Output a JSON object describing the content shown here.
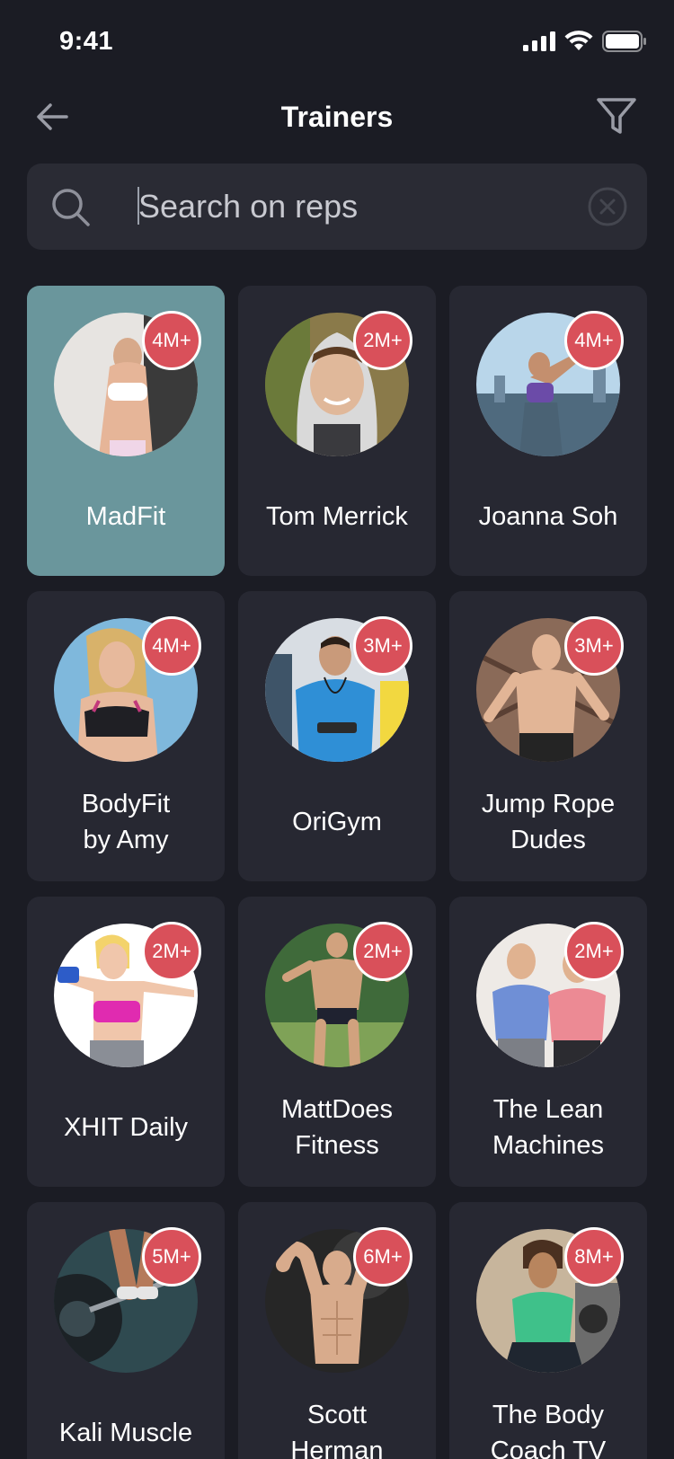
{
  "status": {
    "time": "9:41"
  },
  "header": {
    "title": "Trainers"
  },
  "search": {
    "placeholder": "Search on reps",
    "value": ""
  },
  "colors": {
    "background": "#1b1c24",
    "card": "#272832",
    "selected_card": "#6a969c",
    "badge": "#d9505a"
  },
  "icons": {
    "back": "arrow-left-icon",
    "filter": "funnel-icon",
    "search": "search-icon",
    "clear": "clear-circle-icon"
  },
  "trainers": [
    {
      "name": "MadFit",
      "badge": "4M+",
      "selected": true
    },
    {
      "name": "Tom Merrick",
      "badge": "2M+"
    },
    {
      "name": "Joanna Soh",
      "badge": "4M+"
    },
    {
      "name": "BodyFit\nby Amy",
      "badge": "4M+"
    },
    {
      "name": "OriGym",
      "badge": "3M+"
    },
    {
      "name": "Jump Rope\nDudes",
      "badge": "3M+"
    },
    {
      "name": "XHIT Daily",
      "badge": "2M+"
    },
    {
      "name": "MattDoes\nFitness",
      "badge": "2M+"
    },
    {
      "name": "The Lean\nMachines",
      "badge": "2M+"
    },
    {
      "name": "Kali Muscle",
      "badge": "5M+"
    },
    {
      "name": "Scott\nHerman",
      "badge": "6M+"
    },
    {
      "name": "The Body\nCoach TV",
      "badge": "8M+"
    }
  ]
}
